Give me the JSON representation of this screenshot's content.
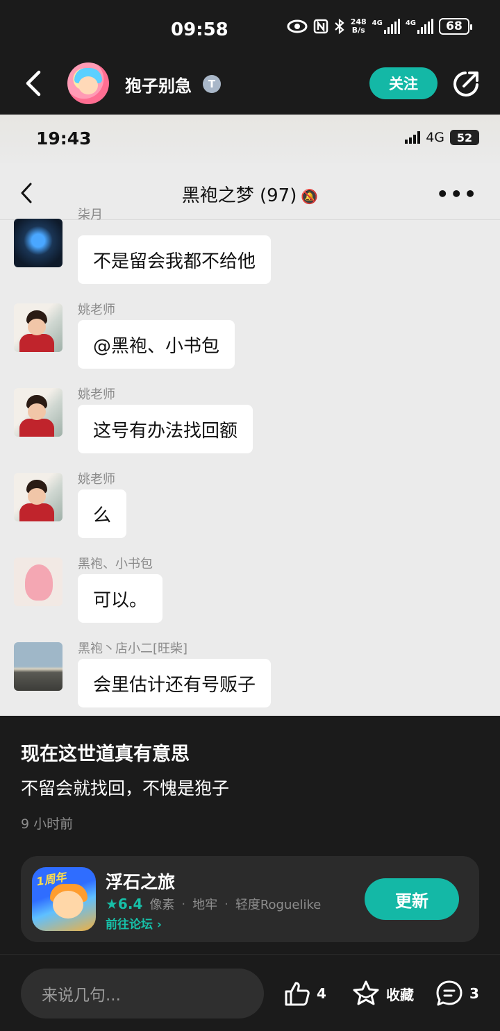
{
  "status_bar": {
    "time": "09:58",
    "speed_top": "248",
    "speed_bottom": "B/s",
    "net1": "4G",
    "net2": "4G",
    "battery": "68"
  },
  "header": {
    "username": "狍子别急",
    "badge": "T",
    "follow_label": "关注"
  },
  "embedded": {
    "time": "19:43",
    "network": "4G",
    "battery": "52",
    "chat_title": "黑袍之梦 (97)",
    "more": "•••",
    "messages": [
      {
        "sender": "柒月",
        "text": "不是留会我都不给他"
      },
      {
        "sender": "姚老师",
        "text": "@黑袍、小书包"
      },
      {
        "sender": "姚老师",
        "text": "这号有办法找回额"
      },
      {
        "sender": "姚老师",
        "text": "么"
      },
      {
        "sender": "黑袍、小书包",
        "text": "可以。"
      },
      {
        "sender": "黑袍丶店小二[旺柴]",
        "text": "会里估计还有号贩子"
      }
    ]
  },
  "post": {
    "title": "现在这世道真有意思",
    "body": "不留会就找回，不愧是狍子",
    "time": "9 小时前"
  },
  "game": {
    "badge": "1周年",
    "name": "浮石之旅",
    "rating": "★6.4",
    "tags": [
      "像素",
      "地牢",
      "轻度Roguelike"
    ],
    "forum_link": "前往论坛 ›",
    "update_label": "更新"
  },
  "bottom": {
    "comment_placeholder": "来说几句...",
    "like_count": "4",
    "favorite_label": "收藏",
    "comment_count": "3"
  },
  "colors": {
    "accent": "#14b8a6",
    "background": "#1b1b1b",
    "card": "#2b2b2b"
  }
}
